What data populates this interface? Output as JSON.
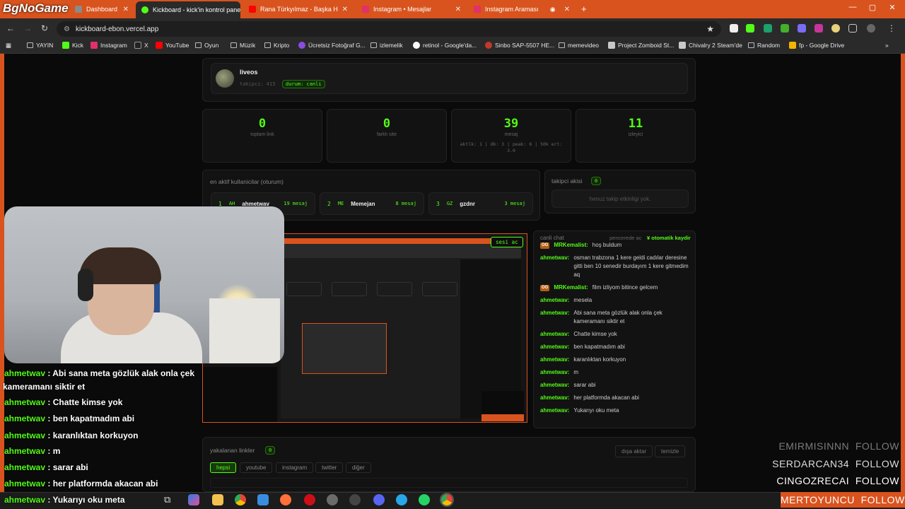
{
  "browser": {
    "tabs": [
      {
        "label": "Dashboard",
        "color": "#8a8a8a"
      },
      {
        "label": "Kickboard - kick'in kontrol pane",
        "color": "#53fc18"
      },
      {
        "label": "Rana Türkyılmaz - Başka Hikaye",
        "color": "#ff0000"
      },
      {
        "label": "Instagram • Mesajlar",
        "color": "#e1306c"
      },
      {
        "label": "Instagram Araması",
        "color": "#e1306c"
      }
    ],
    "url": "kickboard-ebon.vercel.app",
    "bookmarks": [
      "YAYIN",
      "Kick",
      "Instagram",
      "X",
      "YouTube",
      "Oyun",
      "Müzik",
      "Kripto",
      "Ücretsiz Fotoğraf G...",
      "izlemelik",
      "retinol - Google'da...",
      "Sinbo SAP-5507 HE...",
      "memevideo",
      "Project Zomboid St...",
      "Chivalry 2 Steam'de",
      "Random",
      "fp - Google Drive"
    ]
  },
  "watermark": "BgNoGame",
  "channel": {
    "name": "liveos",
    "followers": "takipci: 415",
    "status": "durum: canli"
  },
  "stats": [
    {
      "value": "0",
      "label": "toplam link"
    },
    {
      "value": "0",
      "label": "farklı site"
    },
    {
      "value": "39",
      "label": "mesaj",
      "sub": "aktlk: 1 | dk: 3 | peak: 6 | 50k ert: 3.0"
    },
    {
      "value": "11",
      "label": "izleyici"
    }
  ],
  "active_users": {
    "title": "en aktif kullanicilar (oturum)",
    "items": [
      {
        "rank": "1",
        "initials": "AH",
        "name": "ahmetwav",
        "count": "19 mesaj"
      },
      {
        "rank": "2",
        "initials": "ME",
        "name": "Memejan",
        "count": "8 mesaj"
      },
      {
        "rank": "3",
        "initials": "GZ",
        "name": "gzdnr",
        "count": "3 mesaj"
      }
    ]
  },
  "follow_flow": {
    "title": "takipci akisi",
    "count": "0",
    "empty": "henuz takip etkinligi yok."
  },
  "stream_button": "sesi ac",
  "chat": {
    "title": "canli chat",
    "popout": "pencerede ac",
    "autoscroll": "otomatik kaydir",
    "messages": [
      {
        "badge": "OG",
        "user": "MRKemalist:",
        "text": "hoş buldum"
      },
      {
        "badge": "",
        "user": "ahmetwav:",
        "text": "osman trabzona 1 kere geldi cadılar deresine gitti ben 10 senedir burdayım 1 kere gitmedim aq"
      },
      {
        "badge": "OG",
        "user": "MRKemalist:",
        "text": "film izliyom bitince gelcem"
      },
      {
        "badge": "",
        "user": "ahmetwav:",
        "text": "mesela"
      },
      {
        "badge": "",
        "user": "ahmetwav:",
        "text": "Abi sana meta gözlük alak onla çek kameramanı siktir et"
      },
      {
        "badge": "",
        "user": "ahmetwav:",
        "text": "Chatte kimse yok"
      },
      {
        "badge": "",
        "user": "ahmetwav:",
        "text": "ben kapatmadım abi"
      },
      {
        "badge": "",
        "user": "ahmetwav:",
        "text": "karanlıktan korkuyon"
      },
      {
        "badge": "",
        "user": "ahmetwav:",
        "text": "m"
      },
      {
        "badge": "",
        "user": "ahmetwav:",
        "text": "sarar abi"
      },
      {
        "badge": "",
        "user": "ahmetwav:",
        "text": "her platformda akacan abi"
      },
      {
        "badge": "",
        "user": "ahmetwav:",
        "text": "Yukarıyı oku meta"
      }
    ]
  },
  "links": {
    "title": "yakalanan linkler",
    "count": "0",
    "export": "dışa aktar",
    "clear": "temizle",
    "filters": [
      "hepsi",
      "youtube",
      "instagram",
      "twitter",
      "diğer"
    ]
  },
  "overlay_chat": [
    {
      "user": "ahmetwav",
      "text": " : Abi sana meta gözlük alak onla çek",
      "cont": "kameramanı siktir et"
    },
    {
      "user": "ahmetwav",
      "text": " : Chatte kimse yok"
    },
    {
      "user": "ahmetwav",
      "text": " : ben kapatmadım abi"
    },
    {
      "user": "ahmetwav",
      "text": " : karanlıktan korkuyon"
    },
    {
      "user": "ahmetwav",
      "text": " : m"
    },
    {
      "user": "ahmetwav",
      "text": " : sarar abi"
    },
    {
      "user": "ahmetwav",
      "text": " : her platformda akacan abi"
    },
    {
      "user": "ahmetwav",
      "text": " : Yukarıyı oku meta"
    }
  ],
  "follow_alerts": [
    {
      "name": "EMIRMISINNN",
      "action": "FOLLOW",
      "opacity": 0.45
    },
    {
      "name": "SERDARCAN34",
      "action": "FOLLOW",
      "opacity": 0.85
    },
    {
      "name": "CINGOZRECAI",
      "action": "FOLLOW",
      "opacity": 1
    },
    {
      "name": "MERTOYUNCU",
      "action": "FOLLOW",
      "opacity": 1
    }
  ]
}
